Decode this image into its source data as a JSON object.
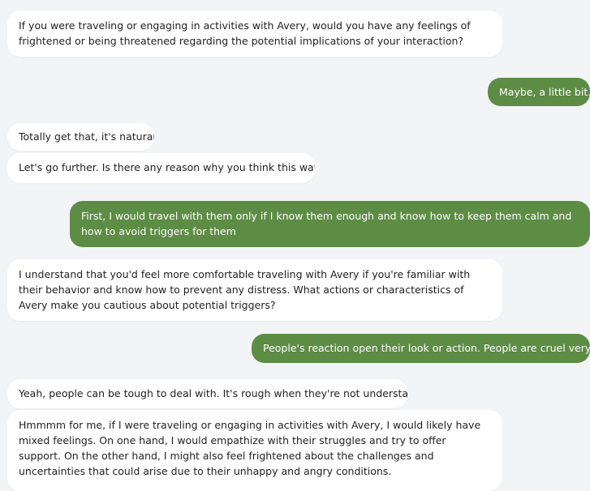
{
  "messages": [
    {
      "sender": "bot",
      "text": "If you were traveling or engaging in activities with Avery, would you have any feelings of frightened or being threatened regarding the potential implications of your interaction?"
    },
    {
      "sender": "user",
      "text": "Maybe, a little bit..."
    },
    {
      "sender": "bot",
      "text": "Totally get that, it's natural."
    },
    {
      "sender": "bot",
      "text": "Let's go further. Is there any reason why you think this way?"
    },
    {
      "sender": "user",
      "text": "First, I would travel with them only if I know them enough and know how to keep them calm and how to avoid triggers for them"
    },
    {
      "sender": "bot",
      "text": "I understand that you'd feel more comfortable traveling with Avery if you're familiar with their behavior and know how to prevent any distress. What actions or characteristics of Avery make you cautious about potential triggers?"
    },
    {
      "sender": "user",
      "text": "People's reaction open their look or action. People are cruel very often"
    },
    {
      "sender": "bot",
      "text": "Yeah, people can be tough to deal with. It's rough when they're not understanding."
    },
    {
      "sender": "bot",
      "text": "Hmmmm for me, if I were traveling or engaging in activities with Avery, I would likely have mixed feelings. On one hand, I would empathize with their struggles and try to offer support. On the other hand, I might also feel frightened about the challenges and uncertainties that could arise due to their unhappy and angry conditions."
    }
  ],
  "colors": {
    "background": "#f3f4f6",
    "bot_bubble": "#ffffff",
    "user_bubble": "#5d8c45",
    "user_text": "#ffffff",
    "bot_text": "#1f1f1f"
  }
}
